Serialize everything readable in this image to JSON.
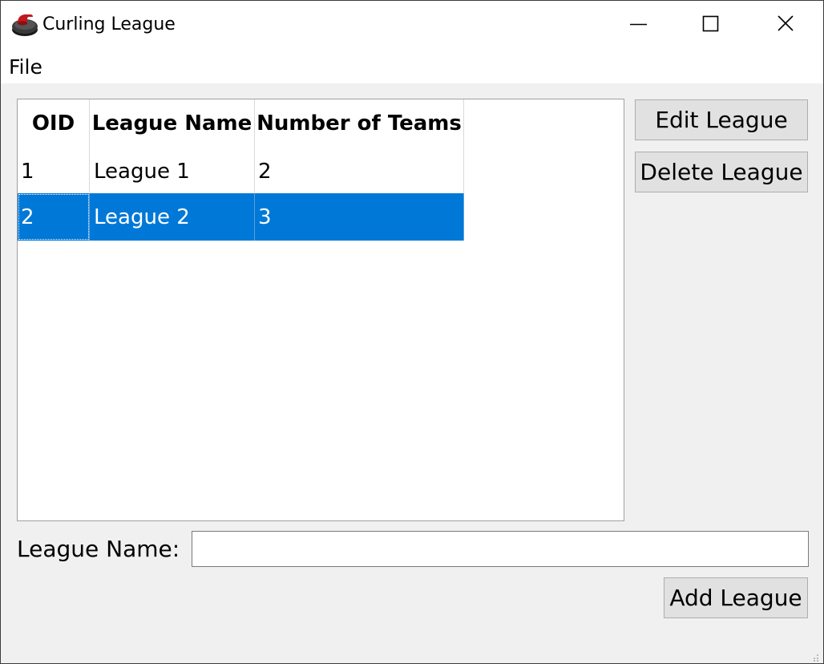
{
  "window": {
    "title": "Curling League",
    "icon": "curling-stone-icon",
    "controls": [
      "minimize-icon",
      "maximize-icon",
      "close-icon"
    ]
  },
  "menu": {
    "items": [
      {
        "label": "File"
      }
    ]
  },
  "table": {
    "columns": [
      "OID",
      "League Name",
      "Number of Teams"
    ],
    "rows": [
      {
        "oid": "1",
        "name": "League 1",
        "teams": "2",
        "selected": false
      },
      {
        "oid": "2",
        "name": "League 2",
        "teams": "3",
        "selected": true
      }
    ]
  },
  "actions": {
    "edit_label": "Edit League",
    "delete_label": "Delete League",
    "add_label": "Add League"
  },
  "form": {
    "name_label": "League Name:",
    "name_value": ""
  },
  "colors": {
    "selection": "#0078d7",
    "window_bg": "#f0f0f0",
    "button_bg": "#e1e1e1",
    "stone_red": "#c0181c"
  }
}
